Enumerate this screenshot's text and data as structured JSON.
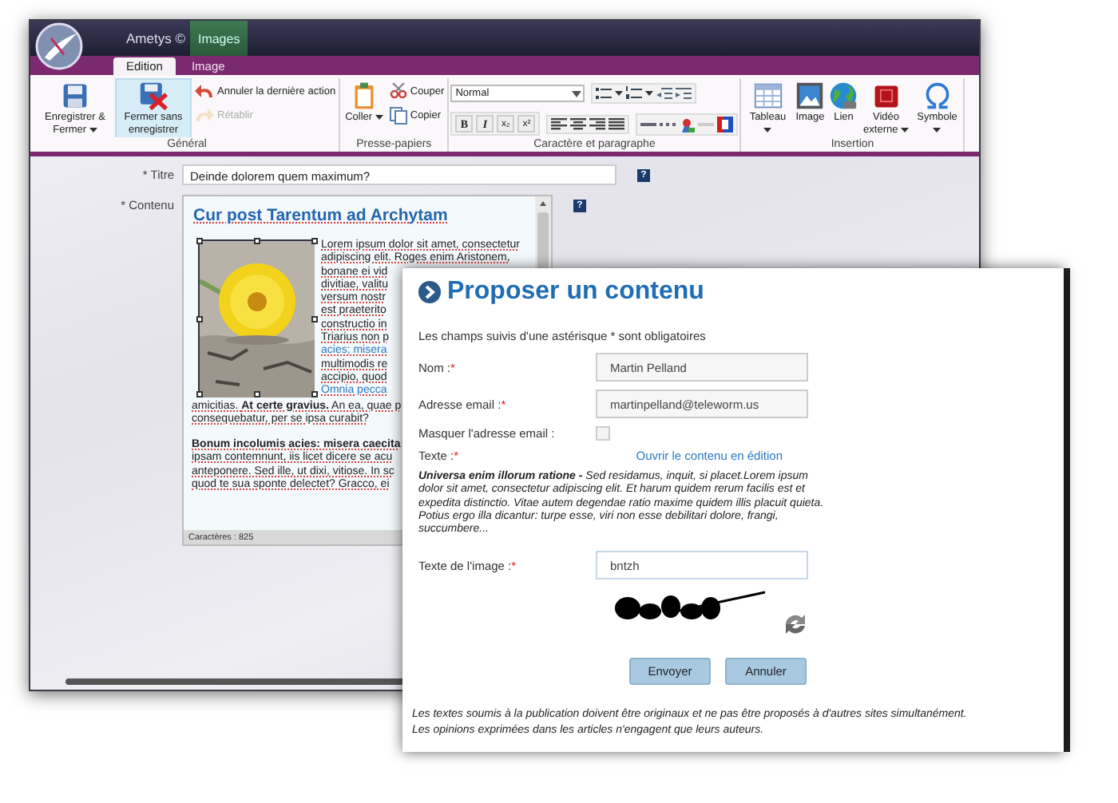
{
  "editor_window": {
    "app_title": "Ametys ©",
    "context_tab": "Images",
    "tabs": [
      {
        "label": "Edition",
        "selected": true
      },
      {
        "label": "Image",
        "selected": false
      }
    ],
    "groups": [
      {
        "kind": "actions",
        "title": "Général",
        "items": [
          {
            "kind": "large",
            "label": "Enregistrer & Fermer",
            "dropdown": true,
            "hovered": false,
            "disabled": false
          },
          {
            "kind": "large",
            "label": "Fermer sans enregistrer",
            "dropdown": false,
            "hovered": true,
            "disabled": false
          },
          {
            "kind": "small",
            "label": "Annuler la dernière action",
            "dropdown": false,
            "hovered": false,
            "disabled": false
          },
          {
            "kind": "small",
            "label": "Rétablir",
            "dropdown": false,
            "hovered": false,
            "disabled": true
          }
        ]
      },
      {
        "kind": "actions",
        "title": "Presse-papiers",
        "items": [
          {
            "kind": "large",
            "label": "Coller",
            "dropdown": true,
            "hovered": false,
            "disabled": false
          },
          {
            "kind": "small",
            "label": "Couper",
            "dropdown": false,
            "hovered": false,
            "disabled": false
          },
          {
            "kind": "small",
            "label": "Copier",
            "dropdown": false,
            "hovered": false,
            "disabled": false
          }
        ]
      },
      {
        "kind": "format",
        "title": "Caractère et paragraphe",
        "font": "Normal",
        "styles": [
          "B",
          "I",
          "x₂",
          "x²"
        ]
      },
      {
        "kind": "actions",
        "title": "Insertion",
        "items": [
          {
            "kind": "large",
            "label": "Tableau",
            "dropdown": true,
            "hovered": false,
            "disabled": false
          },
          {
            "kind": "large",
            "label": "Image",
            "dropdown": false,
            "hovered": false,
            "disabled": false
          },
          {
            "kind": "large",
            "label": "Lien",
            "dropdown": false,
            "hovered": false,
            "disabled": false
          },
          {
            "kind": "large",
            "label": "Vidéo externe",
            "dropdown": true,
            "hovered": false,
            "disabled": false
          },
          {
            "kind": "large",
            "label": "Symbole",
            "dropdown": true,
            "hovered": false,
            "disabled": false
          }
        ]
      }
    ],
    "fields": [
      {
        "kind": "text",
        "label": "* Titre",
        "value": "Deinde dolorem quem maximum?",
        "help": "?"
      },
      {
        "kind": "editor",
        "label": "* Contenu",
        "help": "?"
      }
    ],
    "editor": {
      "heading": "Cur post Tarentum ad Archytam",
      "side_lines": [
        {
          "text": "Lorem ipsum dolor sit amet, consectetur",
          "link": false
        },
        {
          "text": "adipiscing elit. Roges enim Aristonem,",
          "link": false
        },
        {
          "text": "bonane ei vid",
          "link": false
        },
        {
          "text": "divitiae, valitu",
          "link": false
        },
        {
          "text": "versum nostr",
          "link": false
        },
        {
          "text": "est praeterito",
          "link": false
        },
        {
          "text": "constructio in",
          "link": false
        },
        {
          "text": "Triarius non p",
          "link": false
        },
        {
          "text": "acies; misera",
          "link": true
        },
        {
          "text": "multimodis re",
          "link": false
        },
        {
          "text": "accipio, quod",
          "link": false
        },
        {
          "text": "Omnia pecca",
          "link": true
        }
      ],
      "paragraphs": [
        [
          "amicitias. **At certe gravius.** An ea, quae p",
          "consequebatur, per se ipsa curabit?"
        ],
        [
          "**Bonum incolumis acies: misera caecita**",
          "ipsam contemnunt, iis licet dicere se acu",
          "anteponere. Sed ille, ut dixi, vitiose. In sc",
          "quod te sua sponte delectet? Gracco, ei"
        ]
      ],
      "status": "Caractères : 825"
    }
  },
  "dialog": {
    "title": "Proposer un contenu",
    "note": "Les champs suivis d'une astérisque * sont obligatoires",
    "fields": [
      {
        "kind": "text",
        "label": "Nom :",
        "required_mark": "*",
        "value": "Martin Pelland"
      },
      {
        "kind": "text",
        "label": "Adresse email :",
        "required_mark": "*",
        "value": "martinpelland@teleworm.us"
      },
      {
        "kind": "checkbox",
        "label": "Masquer l'adresse email :",
        "checked": false
      },
      {
        "kind": "rich",
        "label": "Texte :",
        "required_mark": "*",
        "link": "Ouvrir le contenu en édition",
        "preview": "**Universa enim illorum ratione -** Sed residamus, inquit, si placet.Lorem ipsum dolor sit amet, consectetur adipiscing elit. Et harum quidem rerum facilis est et expedita distinctio. Vitae autem degendae ratio maxime quidem illis placuit quieta. Potius ergo illa dicantur: turpe esse, viri non esse debilitari dolore, frangi, succumbere..."
      },
      {
        "kind": "captcha",
        "label": "Texte de l'image :",
        "required_mark": "*",
        "value": "bntzh"
      }
    ],
    "buttons": [
      "Envoyer",
      "Annuler"
    ],
    "footer": [
      "Les textes soumis à la publication doivent être originaux et ne pas être proposés à d'autres sites simultanément.",
      "Les opinions exprimées dans les articles n'engagent que leurs auteurs."
    ]
  }
}
